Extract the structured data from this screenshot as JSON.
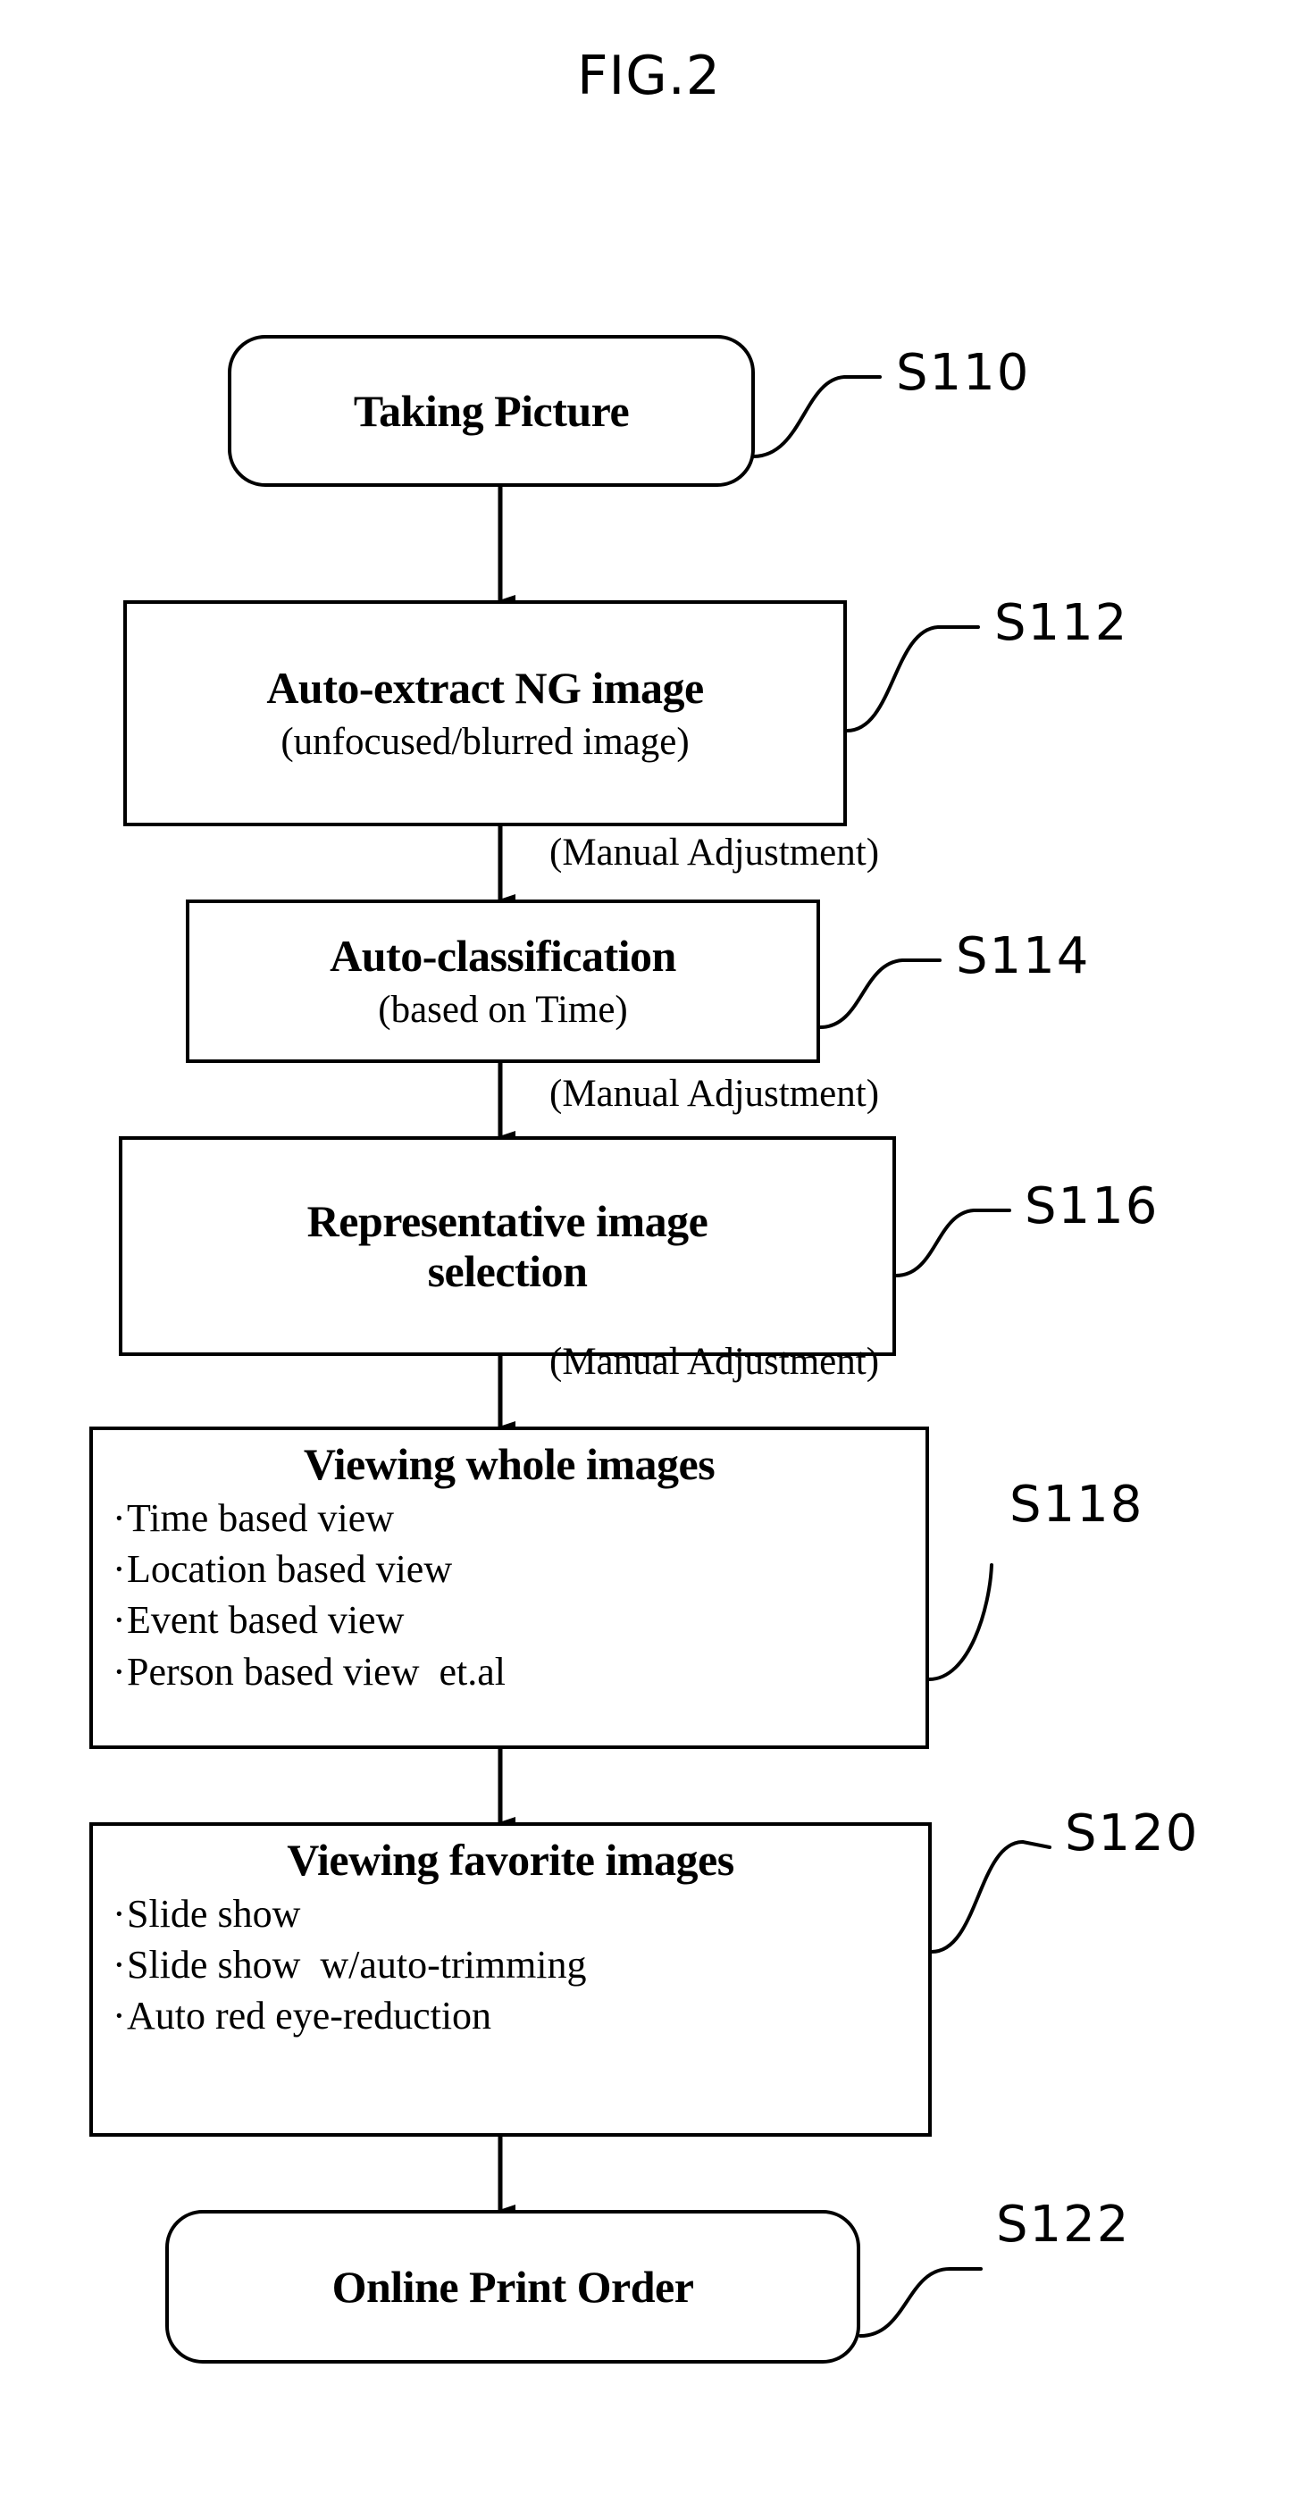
{
  "figure": {
    "title": "FIG.2"
  },
  "nodes": [
    {
      "id": "taking-picture",
      "title": "Taking Picture",
      "sub": "",
      "shape": "terminator",
      "step": "S110"
    },
    {
      "id": "auto-extract-ng-image",
      "title": "Auto-extract NG image",
      "sub": "(unfocused/blurred image)",
      "shape": "rect",
      "step": "S112"
    },
    {
      "id": "auto-classification",
      "title": "Auto-classification",
      "sub": "(based on Time)",
      "shape": "rect",
      "step": "S114"
    },
    {
      "id": "representative-image-selection",
      "title": "Representative image\nselection",
      "sub": "",
      "shape": "rect",
      "step": "S116"
    },
    {
      "id": "viewing-whole-images",
      "title": "Viewing whole images",
      "sub": "",
      "shape": "rect",
      "step": "S118",
      "bullets": [
        "Time based view",
        "Location based view",
        "Event based view",
        "Person based view  et.al"
      ]
    },
    {
      "id": "viewing-favorite-images",
      "title": "Viewing favorite images",
      "sub": "",
      "shape": "rect",
      "step": "S120",
      "bullets": [
        "Slide show",
        "Slide show  w/auto-trimming",
        "Auto red eye-reduction"
      ]
    },
    {
      "id": "online-print-order",
      "title": "Online Print Order",
      "sub": "",
      "shape": "terminator",
      "step": "S122"
    }
  ],
  "annotations": [
    {
      "id": "manual-adjustment-1",
      "text": "(Manual Adjustment)"
    },
    {
      "id": "manual-adjustment-2",
      "text": "(Manual Adjustment)"
    },
    {
      "id": "manual-adjustment-3",
      "text": "(Manual Adjustment)"
    }
  ],
  "style": {
    "ink": "#000000",
    "paper": "#ffffff"
  },
  "bullet_glyph": "·"
}
